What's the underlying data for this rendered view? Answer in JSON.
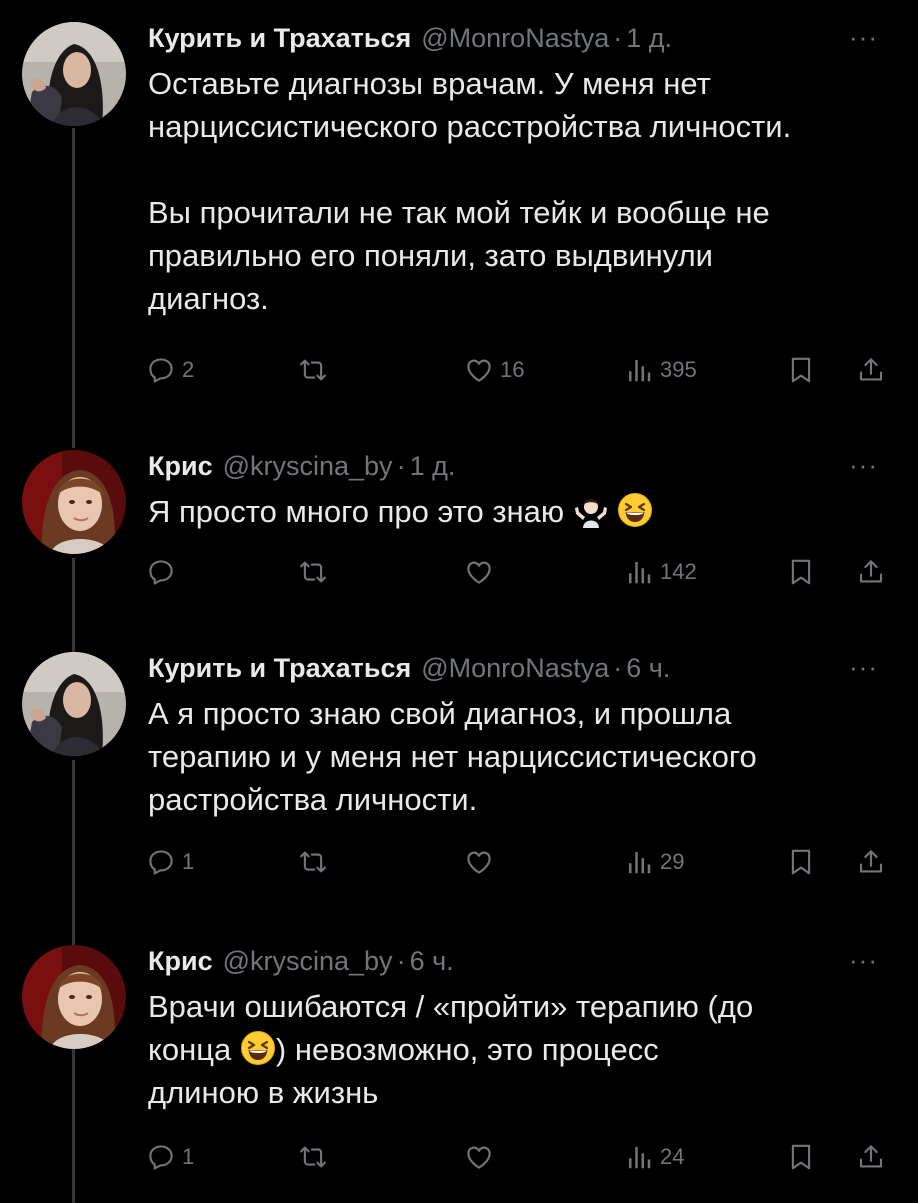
{
  "tweets": [
    {
      "name": "Курить и Трахаться",
      "handle": "@MonroNastya",
      "dot": "·",
      "time": "1 д.",
      "more": "···",
      "text1": "Оставьте диагнозы врачам. У меня нет\nнарциссистического расстройства личности.\n\nВы прочитали не так мой тейк и вообще не\nправильно его поняли, зато выдвинули\nдиагноз.",
      "replies": "2",
      "retweets": "",
      "likes": "16",
      "views": "395"
    },
    {
      "name": "Крис",
      "handle": "@kryscina_by",
      "dot": "·",
      "time": "1 д.",
      "more": "···",
      "text1": "Я просто много про это знаю",
      "emoji_1": "woman-shrugging-emoji",
      "emoji_2": "grinning-squinting-face-emoji",
      "replies": "",
      "retweets": "",
      "likes": "",
      "views": "142"
    },
    {
      "name": "Курить и Трахаться",
      "handle": "@MonroNastya",
      "dot": "·",
      "time": "6 ч.",
      "more": "···",
      "text1": "А я просто знаю свой диагноз, и прошла\nтерапию и у меня нет нарциссистического\nрастройства личности.",
      "replies": "1",
      "retweets": "",
      "likes": "",
      "views": "29"
    },
    {
      "name": "Крис",
      "handle": "@kryscina_by",
      "dot": "·",
      "time": "6 ч.",
      "more": "···",
      "text1": "Врачи ошибаются / «пройти» терапию (до\nконца ",
      "emoji": "grinning-squinting-face-emoji",
      "text2": ") невозможно, это процесс\nдлиною в жизнь",
      "replies": "1",
      "retweets": "",
      "likes": "",
      "views": "24"
    }
  ],
  "colors": {
    "background": "#000000",
    "text": "#e7e9ea",
    "secondary": "#71767b",
    "thread_line": "#333639"
  },
  "icons": [
    "reply-icon",
    "retweet-icon",
    "like-icon",
    "views-icon",
    "bookmark-icon",
    "share-icon"
  ]
}
